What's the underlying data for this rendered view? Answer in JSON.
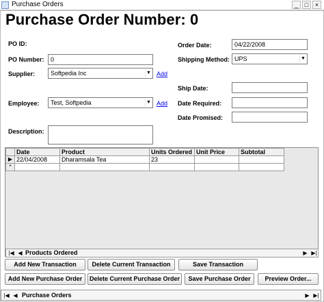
{
  "window": {
    "title": "Purchase Orders"
  },
  "header": {
    "title": "Purchase Order Number: 0"
  },
  "labels": {
    "po_id": "PO ID:",
    "po_number": "PO Number:",
    "supplier": "Supplier:",
    "employee": "Employee:",
    "description": "Description:",
    "order_date": "Order Date:",
    "shipping_method": "Shipping Method:",
    "ship_date": "Ship Date:",
    "date_required": "Date Required:",
    "date_promised": "Date Promised:"
  },
  "fields": {
    "po_number": "0",
    "supplier": "Softpedia Inc",
    "employee": "Test, Softpedia",
    "description": "",
    "order_date": "04/22/2008",
    "shipping_method": "UPS",
    "ship_date": "",
    "date_required": "",
    "date_promised": ""
  },
  "links": {
    "add_supplier": "Add",
    "add_employee": "Add"
  },
  "grid": {
    "columns": [
      "Date",
      "Product",
      "Units Ordered",
      "Unit Price",
      "Subtotal"
    ],
    "rows": [
      {
        "date": "22/04/2008",
        "product": "Dharamsala Tea",
        "units": "23",
        "price": "",
        "subtotal": ""
      }
    ],
    "new_row_marker": "*",
    "current_row_marker": "▶"
  },
  "products_nav": {
    "label": "Products Ordered"
  },
  "buttons": {
    "add_transaction": "Add New Transaction",
    "delete_transaction": "Delete Current Transaction",
    "save_transaction": "Save Transaction",
    "add_po": "Add New Purchase Order",
    "delete_po": "Delete Current Purchase Order",
    "save_po": "Save Purchase Order",
    "preview": "Preview Order..."
  },
  "form_nav": {
    "label": "Purchase Orders"
  }
}
